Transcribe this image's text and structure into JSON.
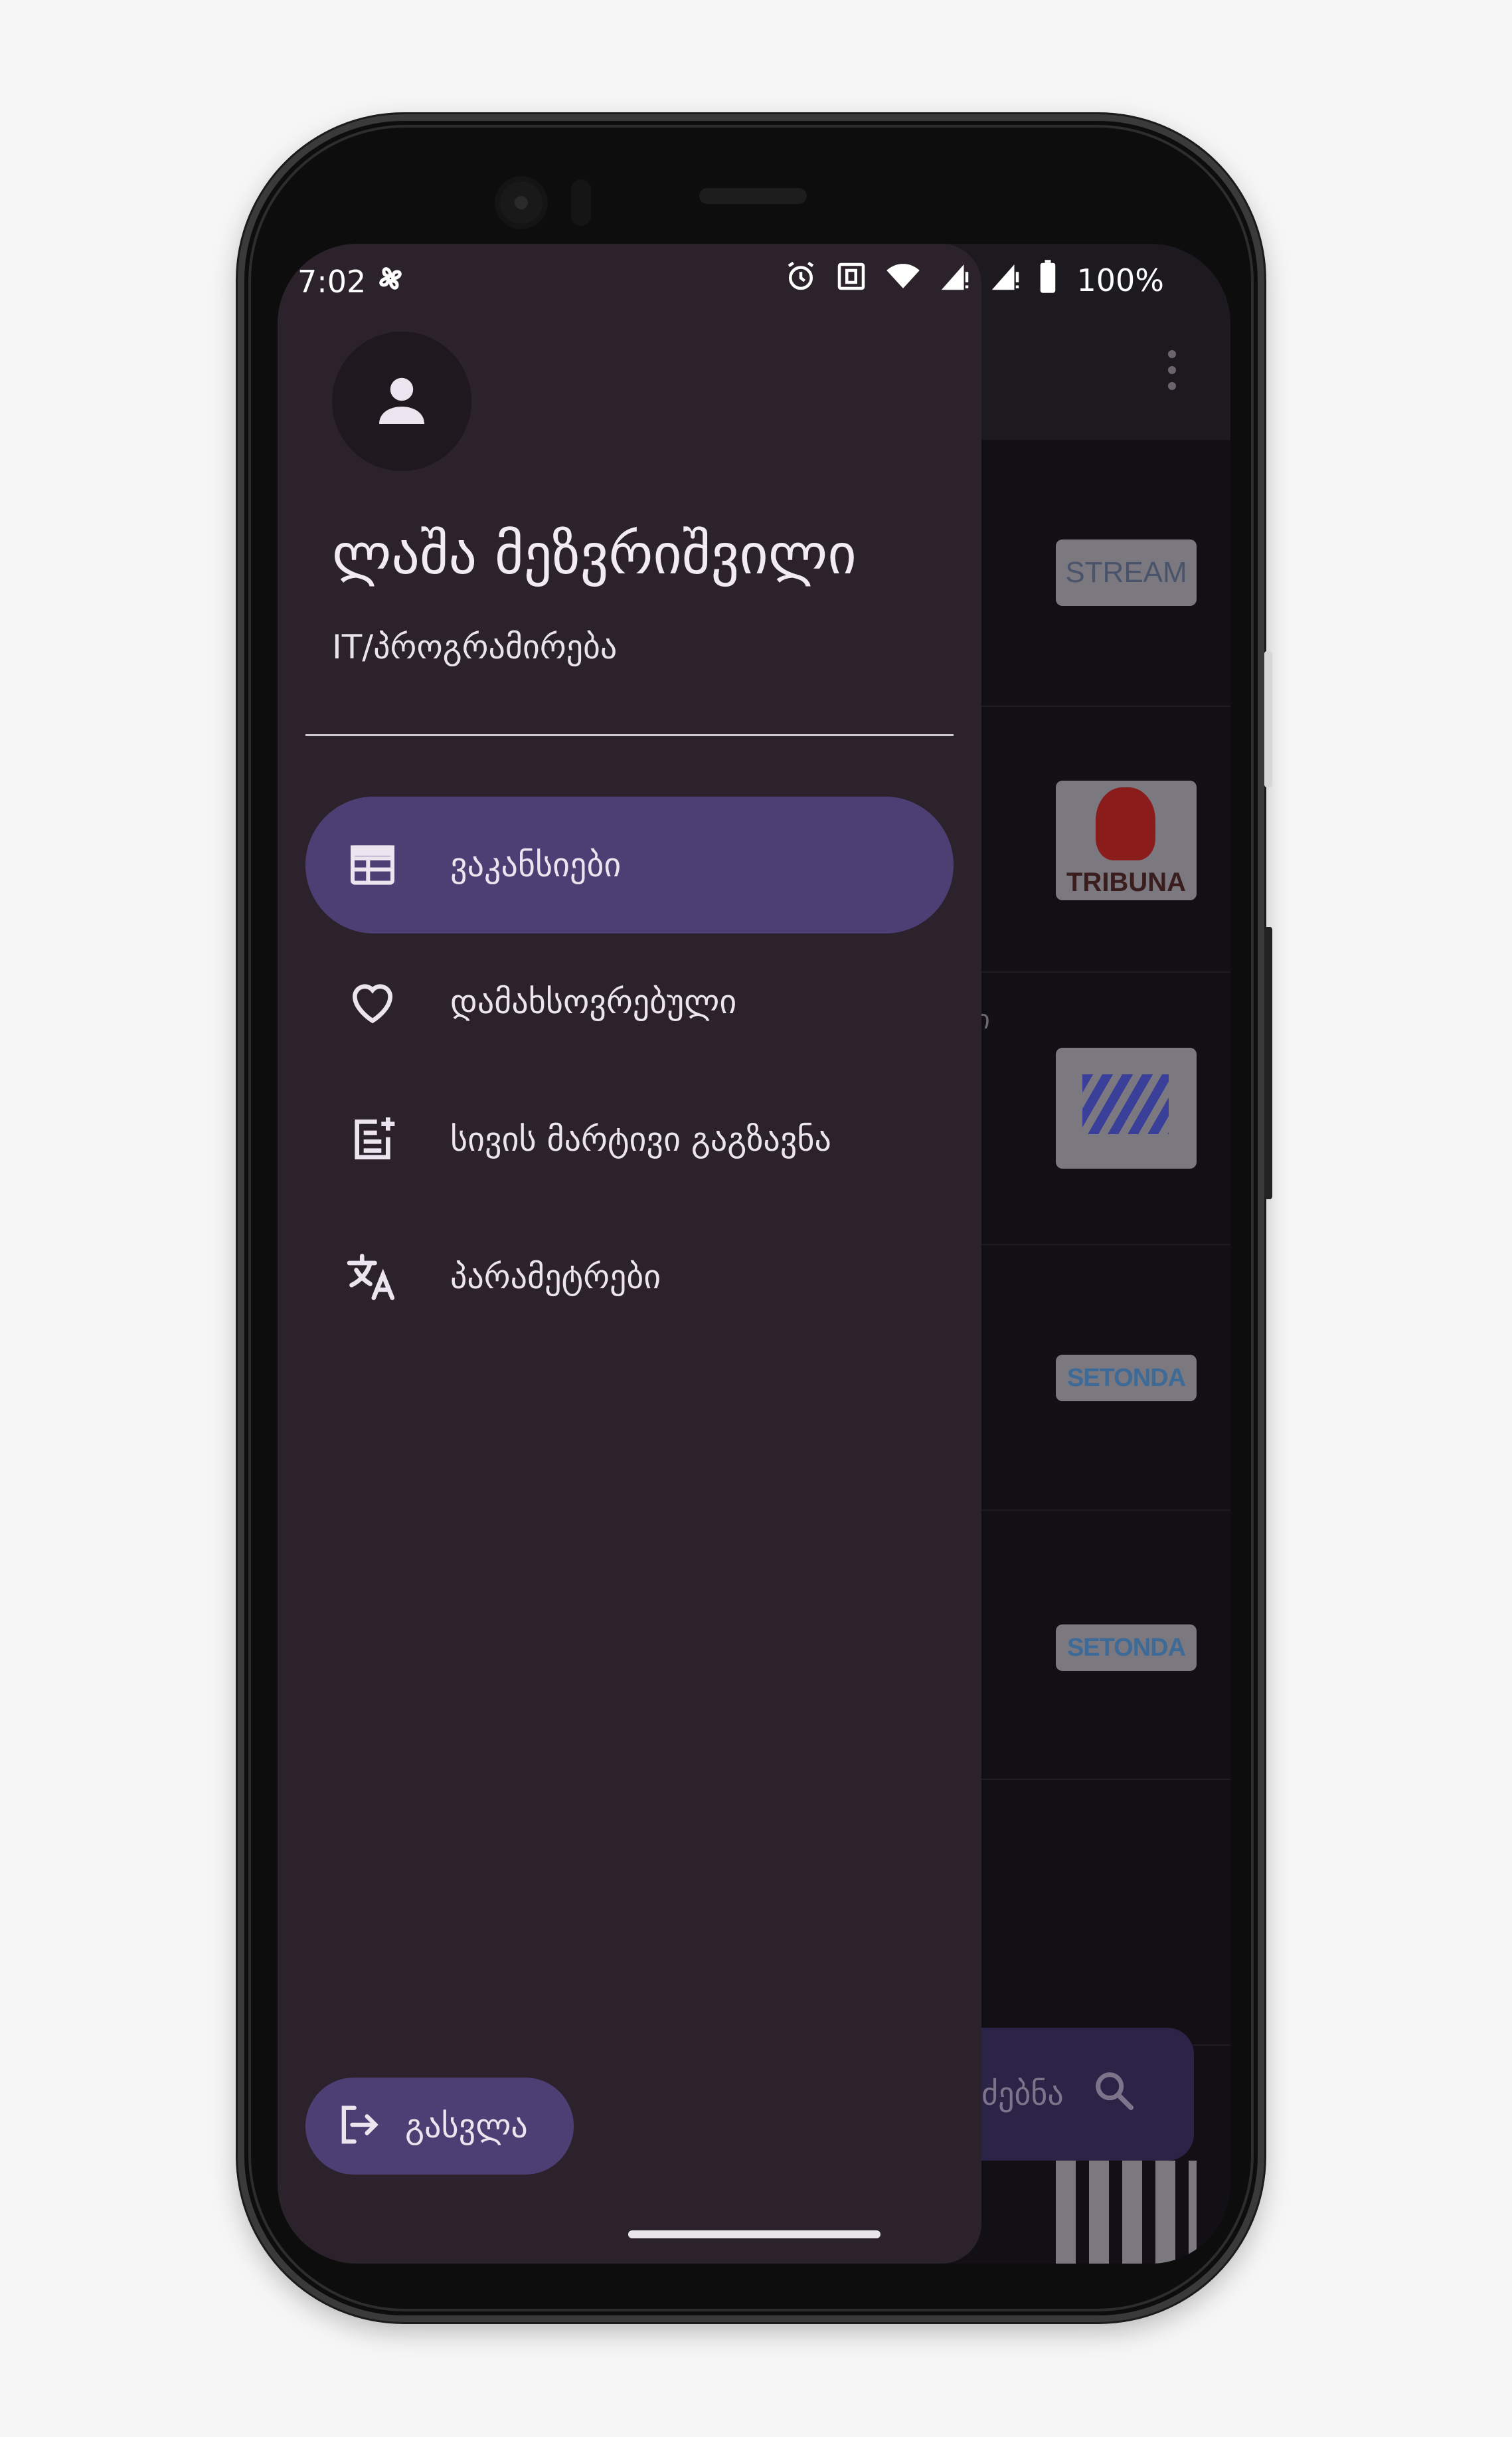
{
  "status_bar": {
    "time": "7:02",
    "battery": "100%"
  },
  "drawer": {
    "user_name": "ლაშა მეზვრიშვილი",
    "user_role": "IT/პროგრამირება",
    "nav_items": [
      {
        "label": "ვაკანსიები",
        "icon": "table-icon",
        "active": true
      },
      {
        "label": "დამახსოვრებული",
        "icon": "heart-icon",
        "active": false
      },
      {
        "label": "სივის მარტივი გაგზავნა",
        "icon": "post-add-icon",
        "active": false
      },
      {
        "label": "პარამეტრები",
        "icon": "translate-icon",
        "active": false
      }
    ],
    "logout_label": "გასვლა"
  },
  "background": {
    "logos": [
      "STREAM",
      "TRIBUNA",
      "SETONDA",
      "SETONDA"
    ],
    "partial_text": "ი",
    "fab_label": "ძებნა"
  },
  "colors": {
    "drawer_bg": "#2b222c",
    "active_item": "#4d3f74",
    "text": "#ece4ee"
  }
}
